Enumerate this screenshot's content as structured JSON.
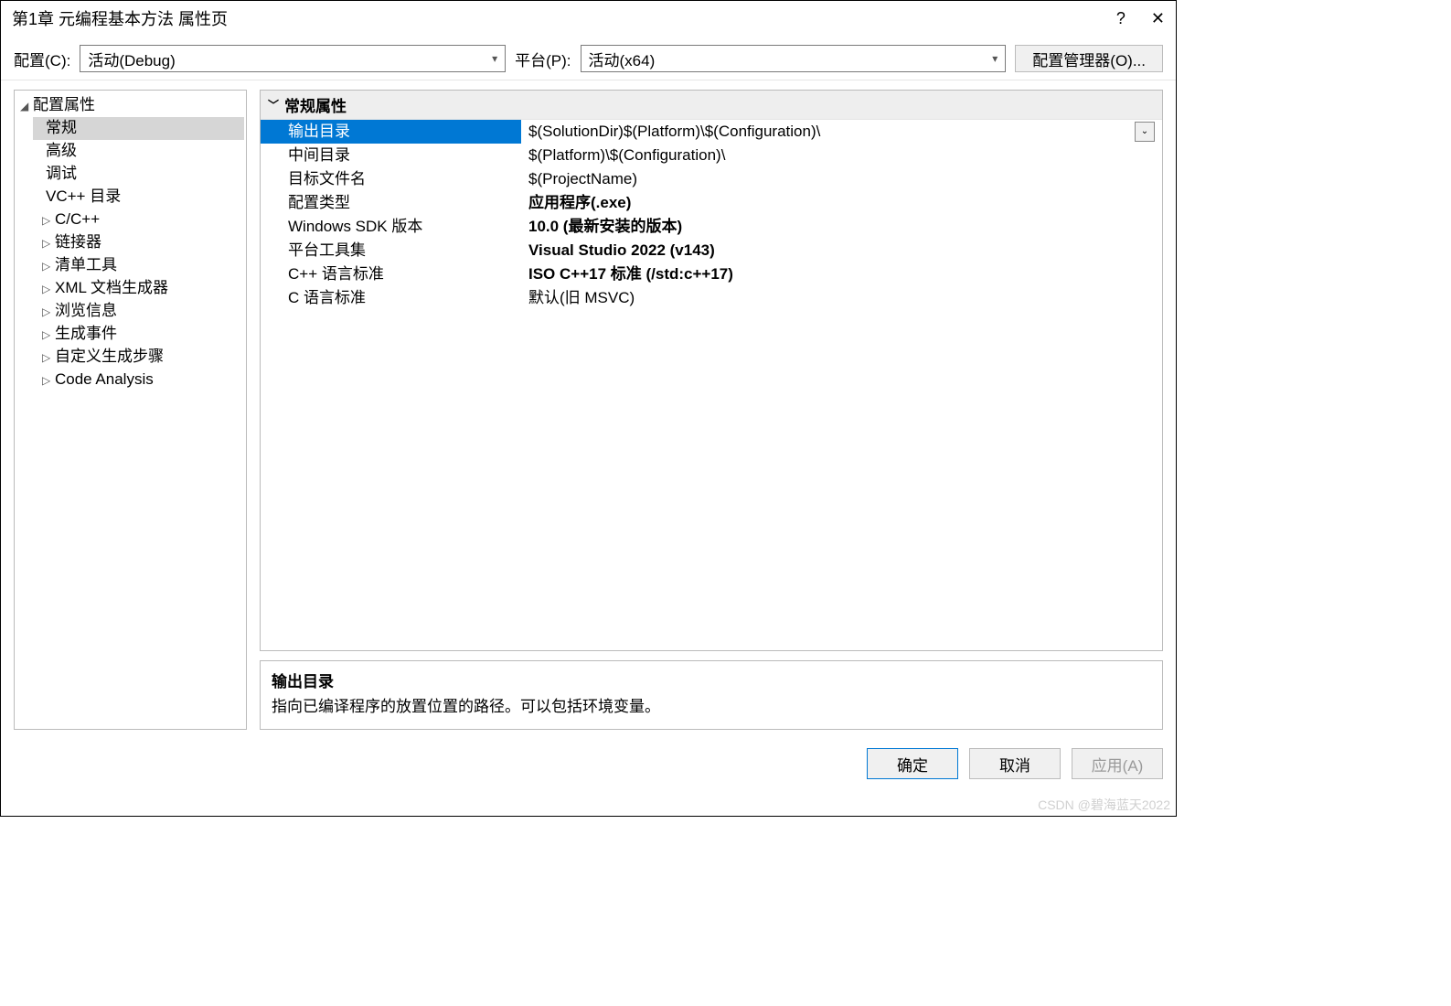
{
  "title": "第1章 元编程基本方法 属性页",
  "titlebar": {
    "help_glyph": "?",
    "close_glyph": "✕"
  },
  "toolbar": {
    "config_label": "配置(C):",
    "config_value": "活动(Debug)",
    "platform_label": "平台(P):",
    "platform_value": "活动(x64)",
    "manager_button": "配置管理器(O)..."
  },
  "tree": {
    "root": {
      "label": "配置属性",
      "expanded": true
    },
    "items": [
      {
        "label": "常规",
        "leaf": true,
        "selected": true
      },
      {
        "label": "高级",
        "leaf": true
      },
      {
        "label": "调试",
        "leaf": true
      },
      {
        "label": "VC++ 目录",
        "leaf": true
      },
      {
        "label": "C/C++"
      },
      {
        "label": "链接器"
      },
      {
        "label": "清单工具"
      },
      {
        "label": "XML 文档生成器"
      },
      {
        "label": "浏览信息"
      },
      {
        "label": "生成事件"
      },
      {
        "label": "自定义生成步骤"
      },
      {
        "label": "Code Analysis"
      }
    ]
  },
  "properties": {
    "group_title": "常规属性",
    "rows": [
      {
        "label": "输出目录",
        "value": "$(SolutionDir)$(Platform)\\$(Configuration)\\",
        "selected": true
      },
      {
        "label": "中间目录",
        "value": "$(Platform)\\$(Configuration)\\"
      },
      {
        "label": "目标文件名",
        "value": "$(ProjectName)"
      },
      {
        "label": "配置类型",
        "value": "应用程序(.exe)",
        "bold": true
      },
      {
        "label": "Windows SDK 版本",
        "value": "10.0 (最新安装的版本)",
        "bold": true
      },
      {
        "label": "平台工具集",
        "value": "Visual Studio 2022 (v143)",
        "bold": true
      },
      {
        "label": "C++ 语言标准",
        "value": "ISO C++17 标准 (/std:c++17)",
        "bold": true
      },
      {
        "label": "C 语言标准",
        "value": "默认(旧 MSVC)"
      }
    ]
  },
  "help": {
    "title": "输出目录",
    "text": "指向已编译程序的放置位置的路径。可以包括环境变量。"
  },
  "footer": {
    "ok": "确定",
    "cancel": "取消",
    "apply": "应用(A)"
  },
  "watermark": "CSDN @碧海蓝天2022"
}
